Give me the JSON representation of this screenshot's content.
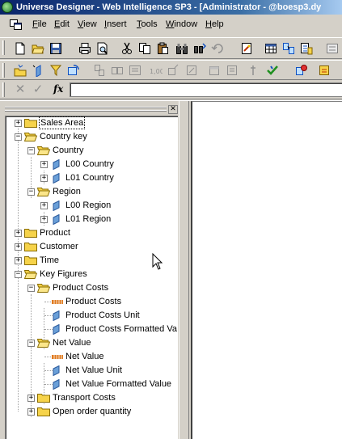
{
  "window": {
    "title": "Universe Designer - Web Intelligence SP3 - [Administrator - @boesp3.dy"
  },
  "menubar": {
    "items": [
      {
        "key": "F",
        "rest": "ile"
      },
      {
        "key": "E",
        "rest": "dit"
      },
      {
        "key": "V",
        "rest": "iew"
      },
      {
        "key": "I",
        "rest": "nsert"
      },
      {
        "key": "T",
        "rest": "ools"
      },
      {
        "key": "W",
        "rest": "indow"
      },
      {
        "key": "H",
        "rest": "elp"
      }
    ]
  },
  "formula_bar": {
    "fx_label": "fx",
    "value": ""
  },
  "tree": {
    "items": [
      {
        "label": "Sales Area",
        "type": "class",
        "selected": true
      },
      {
        "label": "Country key",
        "type": "class"
      },
      {
        "label": "Country",
        "type": "class"
      },
      {
        "label": "L00 Country",
        "type": "dimension"
      },
      {
        "label": "L01 Country",
        "type": "dimension"
      },
      {
        "label": "Region",
        "type": "class"
      },
      {
        "label": "L00 Region",
        "type": "dimension"
      },
      {
        "label": "L01 Region",
        "type": "dimension"
      },
      {
        "label": "Product",
        "type": "class"
      },
      {
        "label": "Customer",
        "type": "class"
      },
      {
        "label": "Time",
        "type": "class"
      },
      {
        "label": "Key Figures",
        "type": "class"
      },
      {
        "label": "Product Costs",
        "type": "class"
      },
      {
        "label": "Product Costs",
        "type": "measure"
      },
      {
        "label": "Product Costs Unit",
        "type": "dimension"
      },
      {
        "label": "Product Costs Formatted Va",
        "type": "dimension"
      },
      {
        "label": "Net Value",
        "type": "class"
      },
      {
        "label": "Net Value",
        "type": "measure"
      },
      {
        "label": "Net Value Unit",
        "type": "dimension"
      },
      {
        "label": "Net Value Formatted Value",
        "type": "dimension"
      },
      {
        "label": "Transport Costs",
        "type": "class"
      },
      {
        "label": "Open order quantity",
        "type": "class"
      }
    ]
  },
  "icons": {
    "folder": "folder-icon",
    "dimension": "dimension-object-icon",
    "measure": "measure-object-icon"
  },
  "colors": {
    "title_start": "#0a246a",
    "title_end": "#a6caf0",
    "folder": "#f6d34a",
    "dimension": "#6a9fd8",
    "measure": "#e07b20"
  }
}
